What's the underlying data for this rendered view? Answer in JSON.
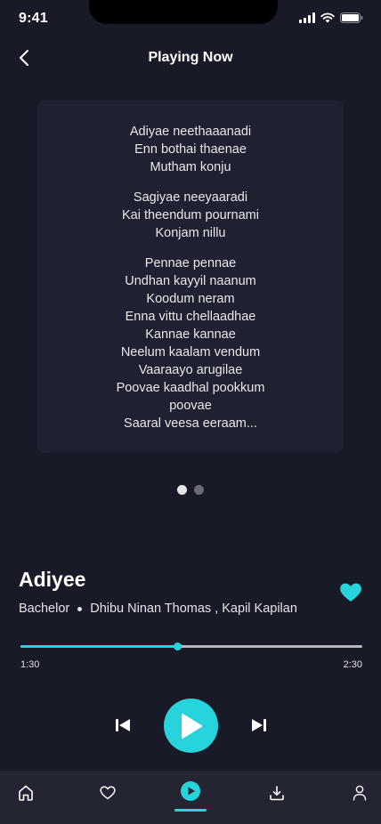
{
  "status_bar": {
    "time": "9:41"
  },
  "header": {
    "title": "Playing Now"
  },
  "lyrics": {
    "stanzas": [
      [
        "Adiyae neethaaanadi",
        "Enn bothai thaenae",
        "Mutham konju"
      ],
      [
        "Sagiyae neeyaaradi",
        "Kai theendum pournami",
        "Konjam nillu"
      ],
      [
        "Pennae pennae",
        "Undhan kayyil naanum",
        "Koodum neram",
        "Enna vittu chellaadhae",
        "Kannae kannae",
        "Neelum kaalam vendum",
        "Vaaraayo arugilae",
        "Poovae kaadhal pookkum",
        "poovae",
        "Saaral veesa eeraam..."
      ]
    ]
  },
  "pager": {
    "total": 2,
    "active_index": 0
  },
  "song": {
    "title": "Adiyee",
    "album": "Bachelor",
    "artists": "Dhibu Ninan Thomas , Kapil Kapilan",
    "liked": true
  },
  "playback": {
    "current_time": "1:30",
    "total_time": "2:30",
    "progress_fraction": 0.46
  },
  "nav": {
    "items": [
      "home-icon",
      "heart-icon",
      "play-circle-icon",
      "download-icon",
      "profile-icon"
    ],
    "active": "play-circle-icon"
  },
  "colors": {
    "background": "#191a27",
    "card": "#1f2030",
    "accent": "#27d4dc",
    "nav_background": "#242533"
  }
}
